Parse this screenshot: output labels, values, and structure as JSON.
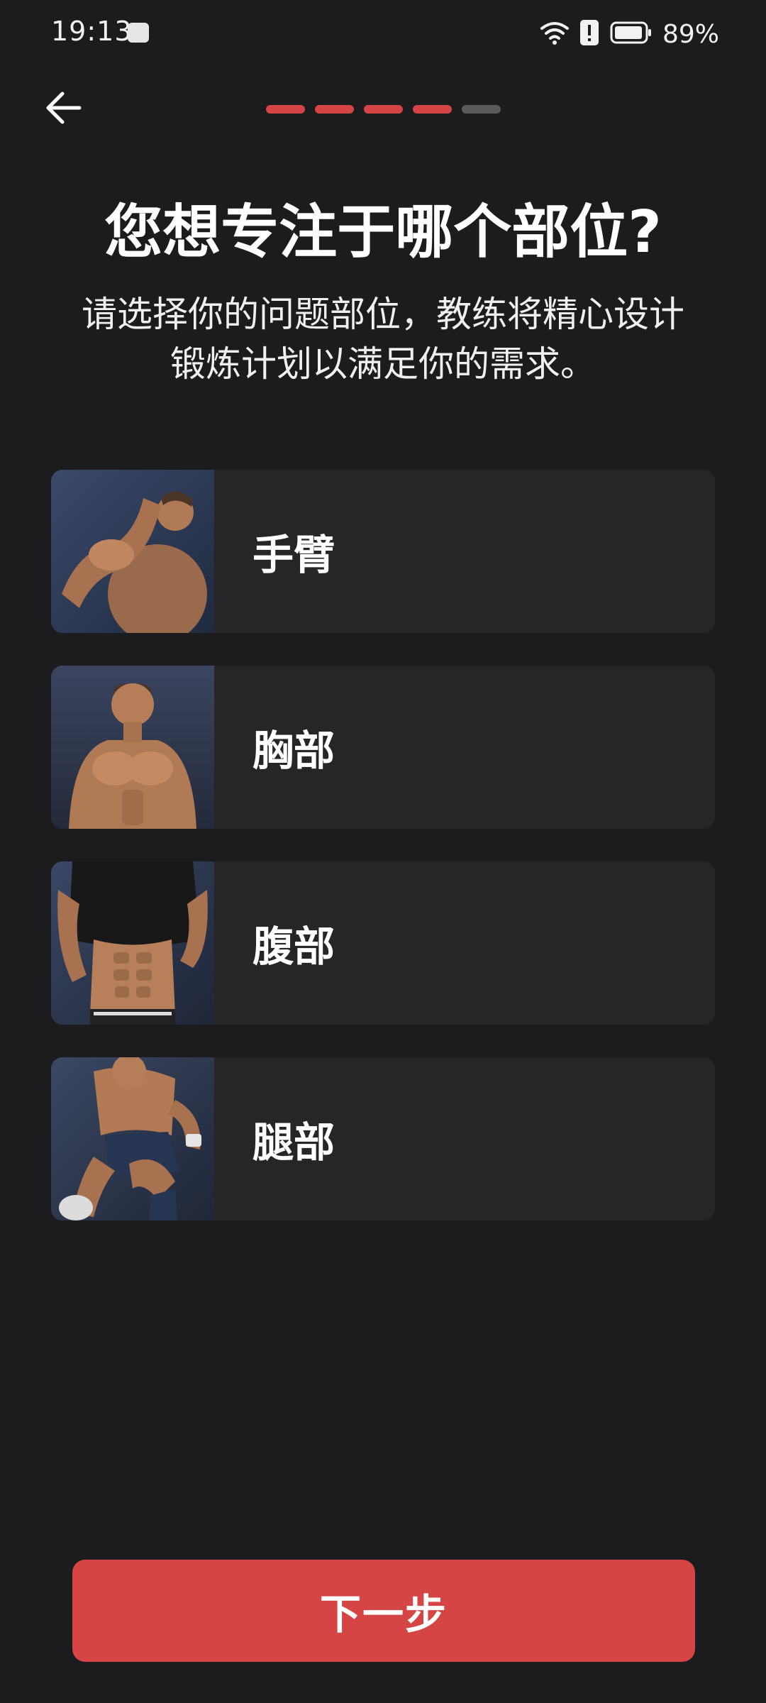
{
  "status": {
    "time": "19:13",
    "battery": "89%",
    "icons": [
      "huawei-app-icon",
      "wifi-icon",
      "alert-icon",
      "battery-icon"
    ]
  },
  "header": {
    "back_icon": "arrow-left-icon",
    "progress_total": 5,
    "progress_completed": 4
  },
  "title": "您想专注于哪个部位?",
  "subtitle_line1": "请选择你的问题部位，教练将精心设计",
  "subtitle_line2": "锻炼计划以满足你的需求。",
  "options": [
    {
      "label": "手臂",
      "image": "arms-photo"
    },
    {
      "label": "胸部",
      "image": "chest-photo"
    },
    {
      "label": "腹部",
      "image": "abs-photo"
    },
    {
      "label": "腿部",
      "image": "legs-photo"
    }
  ],
  "next_label": "下一步",
  "colors": {
    "background": "#1c1c1e",
    "card": "#262628",
    "accent": "#d64545",
    "progress_inactive": "#5a5a5c"
  }
}
